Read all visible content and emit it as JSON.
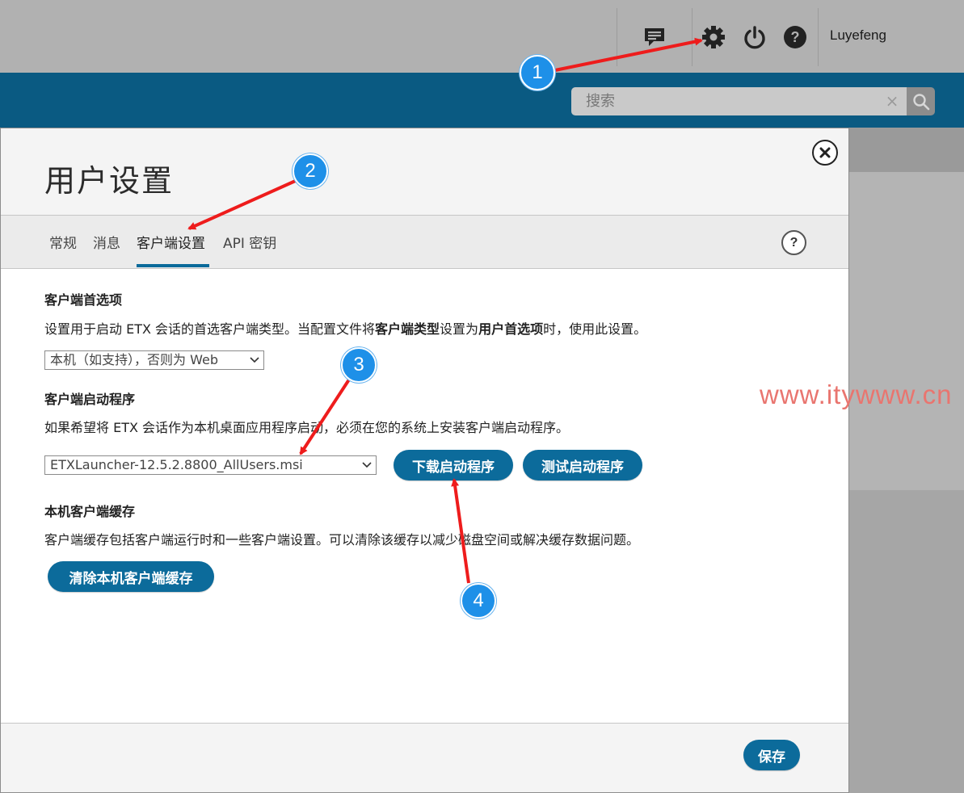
{
  "topbar": {
    "username": "Luyefeng",
    "icons": [
      "chat-icon",
      "gear-icon",
      "power-icon",
      "help-icon"
    ]
  },
  "search": {
    "placeholder": "搜索",
    "clear": "×"
  },
  "dialog": {
    "title": "用户设置",
    "tabs": [
      "常规",
      "消息",
      "客户端设置",
      "API 密钥"
    ],
    "active_tab": "客户端设置",
    "help": "?",
    "sections": {
      "preference": {
        "title": "客户端首选项",
        "desc_pre": "设置用于启动 ETX 会话的首选客户端类型。当配置文件将",
        "desc_b1": "客户端类型",
        "desc_mid": "设置为",
        "desc_b2": "用户首选项",
        "desc_post": "时，使用此设置。",
        "select_value": "本机（如支持），否则为 Web"
      },
      "launcher": {
        "title": "客户端启动程序",
        "desc": "如果希望将 ETX 会话作为本机桌面应用程序启动，必须在您的系统上安装客户端启动程序。",
        "select_value": "ETXLauncher-12.5.2.8800_AllUsers.msi",
        "download_btn": "下载启动程序",
        "test_btn": "测试启动程序"
      },
      "cache": {
        "title": "本机客户端缓存",
        "desc": "客户端缓存包括客户端运行时和一些客户端设置。可以清除该缓存以减少磁盘空间或解决缓存数据问题。",
        "clear_btn": "清除本机客户端缓存"
      }
    },
    "save_btn": "保存"
  },
  "annotations": {
    "badges": [
      "1",
      "2",
      "3",
      "4"
    ],
    "color": "#1e90e8",
    "arrow_color": "#ee1c1c"
  },
  "watermark": "www.itywww.cn",
  "colors": {
    "brand_blue": "#0a5a82",
    "button_blue": "#0c6b9b"
  }
}
